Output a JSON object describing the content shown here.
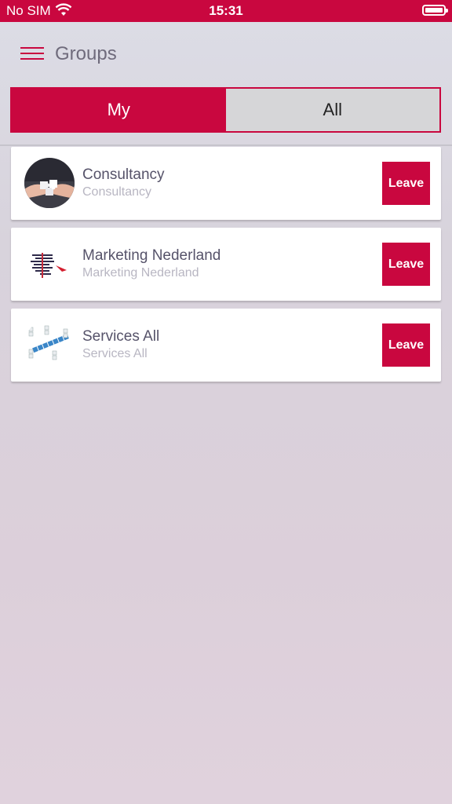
{
  "status": {
    "carrier": "No SIM",
    "time": "15:31",
    "wifi_icon": "wifi-icon",
    "battery_icon": "battery-icon"
  },
  "header": {
    "title": "Groups",
    "menu_icon": "hamburger-menu-icon"
  },
  "tabs": [
    {
      "label": "My",
      "active": true
    },
    {
      "label": "All",
      "active": false
    }
  ],
  "groups": [
    {
      "title": "Consultancy",
      "subtitle": "Consultancy",
      "button": "Leave",
      "image": "puzzle-hands-image"
    },
    {
      "title": "Marketing Nederland",
      "subtitle": "Marketing Nederland",
      "button": "Leave",
      "image": "marketing-words-image"
    },
    {
      "title": "Services All",
      "subtitle": "Services All",
      "button": "Leave",
      "image": "service-crossword-image"
    }
  ],
  "colors": {
    "accent": "#c9073f",
    "tab_inactive": "#d6d6d8",
    "title_text": "#56536a",
    "subtitle_text": "#b8b6c2"
  }
}
